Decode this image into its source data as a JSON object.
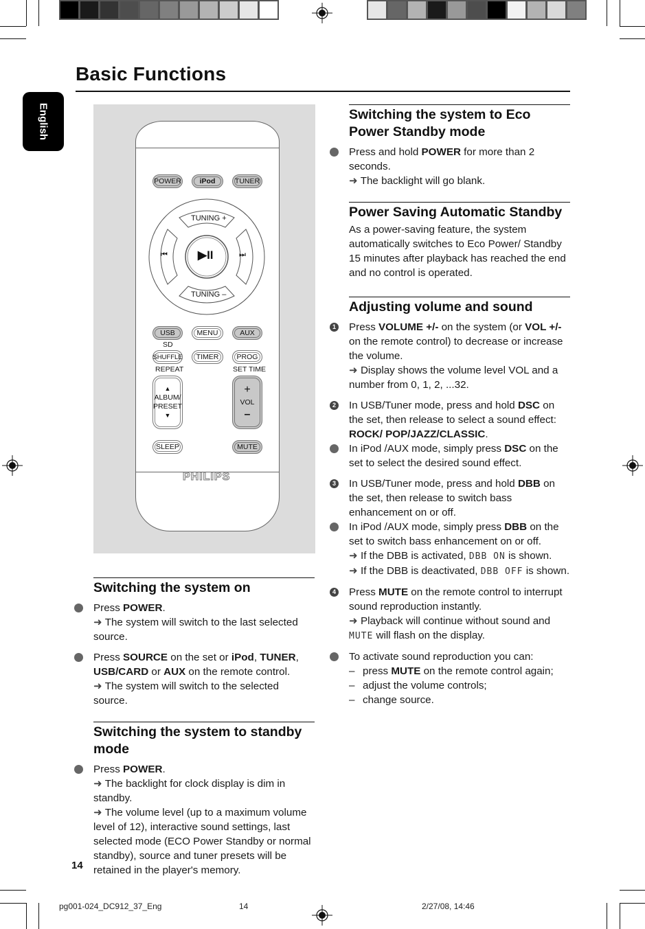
{
  "page": {
    "title": "Basic Functions",
    "language_tab": "English",
    "page_number": "14"
  },
  "print_marks": {
    "colorbar_left": [
      "#000000",
      "#1a1a1a",
      "#333333",
      "#4d4d4d",
      "#666666",
      "#808080",
      "#999999",
      "#b3b3b3",
      "#cccccc",
      "#e6e6e6",
      "#ffffff"
    ],
    "colorbar_right": [
      "#e6e6e6",
      "#666666",
      "#b3b3b3",
      "#1a1a1a",
      "#999999",
      "#4d4d4d",
      "#000000",
      "#f2f2f2",
      "#b3b3b3",
      "#d9d9d9",
      "#808080"
    ],
    "slug_file": "pg001-024_DC912_37_Eng",
    "slug_page": "14",
    "slug_date": "2/27/08, 14:46"
  },
  "remote": {
    "top_row": [
      "POWER",
      "iPod",
      "TUNER"
    ],
    "tuning_plus": "TUNING +",
    "tuning_minus": "TUNING –",
    "prev": "⏮",
    "next": "⏭",
    "play_pause": "▶II",
    "row2": [
      "USB",
      "MENU",
      "AUX"
    ],
    "sd_label": "SD",
    "row3": [
      "SHUFFLE",
      "TIMER",
      "PROG"
    ],
    "repeat_label": "REPEAT",
    "set_time_label": "SET TIME",
    "album_up": "▲",
    "album_label_1": "ALBUM/",
    "album_label_2": "PRESET",
    "album_down": "▼",
    "vol_plus": "+",
    "vol_label": "VOL",
    "vol_minus": "–",
    "sleep": "SLEEP",
    "mute": "MUTE",
    "brand": "PHILIPS"
  },
  "sections": {
    "on": {
      "title": "Switching the system on",
      "i1_pre": "Press ",
      "i1_b": "POWER",
      "i1_post": ".",
      "i1_arrow": "The system will switch to the last selected source.",
      "i2_a": "Press ",
      "i2_b1": "SOURCE",
      "i2_c": " on the set or ",
      "i2_b2": "iPod",
      "i2_d": ", ",
      "i2_b3": "TUNER",
      "i2_e": ", ",
      "i2_b4": "USB/CARD",
      "i2_f": " or ",
      "i2_b5": "AUX",
      "i2_g": " on the remote control.",
      "i2_arrow": "The system will switch to the selected source."
    },
    "standby": {
      "title": "Switching the system to standby mode",
      "i1_pre": "Press ",
      "i1_b": "POWER",
      "i1_post": ".",
      "arrow1": "The backlight for clock display is dim in standby.",
      "arrow2": "The volume level (up to a maximum volume level of 12), interactive sound settings, last selected mode (ECO Power  Standby or normal standby), source and tuner presets will be retained in the player's memory."
    },
    "eco": {
      "title": "Switching the system to Eco Power Standby mode",
      "i1_pre": "Press and hold ",
      "i1_b": "POWER",
      "i1_post": " for more than 2 seconds.",
      "arrow": "The backlight will go blank."
    },
    "auto": {
      "title": "Power Saving Automatic Standby",
      "body": "As a power-saving feature, the system automatically switches to Eco Power/ Standby 15 minutes after playback has reached the end and no control is operated."
    },
    "volume": {
      "title": "Adjusting volume and sound",
      "s1_num": "1",
      "s1_a": "Press ",
      "s1_b1": "VOLUME +/-",
      "s1_c": " on the system (or ",
      "s1_b2": "VOL +/-",
      "s1_d": " on the remote control) to decrease or increase the volume.",
      "s1_arrow": "Display shows the volume level VOL and a number from 0, 1, 2, ...32.",
      "s2_num": "2",
      "s2_a": "In USB/Tuner mode, press and hold ",
      "s2_b": "DSC",
      "s2_c": " on the set, then release to select a sound effect: ",
      "s2_d": "ROCK/ POP/JAZZ/CLASSIC",
      "s2_e": ".",
      "s2b_a": "In iPod /AUX mode, simply press ",
      "s2b_b": "DSC",
      "s2b_c": " on the set to select the desired sound effect.",
      "s3_num": "3",
      "s3_a": "In USB/Tuner mode, press and hold ",
      "s3_b": "DBB",
      "s3_c": " on the set, then release to switch bass enhancement on or off.",
      "s3b_a": "In iPod /AUX mode, simply press ",
      "s3b_b": "DBB",
      "s3b_c": " on the set to switch bass enhancement on or off.",
      "s3b_arrow1_a": "If the DBB is activated, ",
      "s3b_arrow1_lcd": "DBB ON",
      "s3b_arrow1_b": " is shown.",
      "s3b_arrow2_a": "If the DBB is deactivated, ",
      "s3b_arrow2_lcd": "DBB OFF",
      "s3b_arrow2_b": " is shown.",
      "s4_num": "4",
      "s4_a": "Press ",
      "s4_b": "MUTE",
      "s4_c": " on the remote control to interrupt sound reproduction instantly.",
      "s4_arrow_a": "Playback will continue without sound and ",
      "s4_arrow_lcd": "MUTE",
      "s4_arrow_b": " will flash on the display.",
      "s4b_intro": "To activate sound reproduction you can:",
      "s4b_d1_a": "press ",
      "s4b_d1_b": "MUTE",
      "s4b_d1_c": " on the remote control again;",
      "s4b_d2": "adjust the volume controls;",
      "s4b_d3": "change source."
    }
  },
  "arrow_glyph": "➜"
}
